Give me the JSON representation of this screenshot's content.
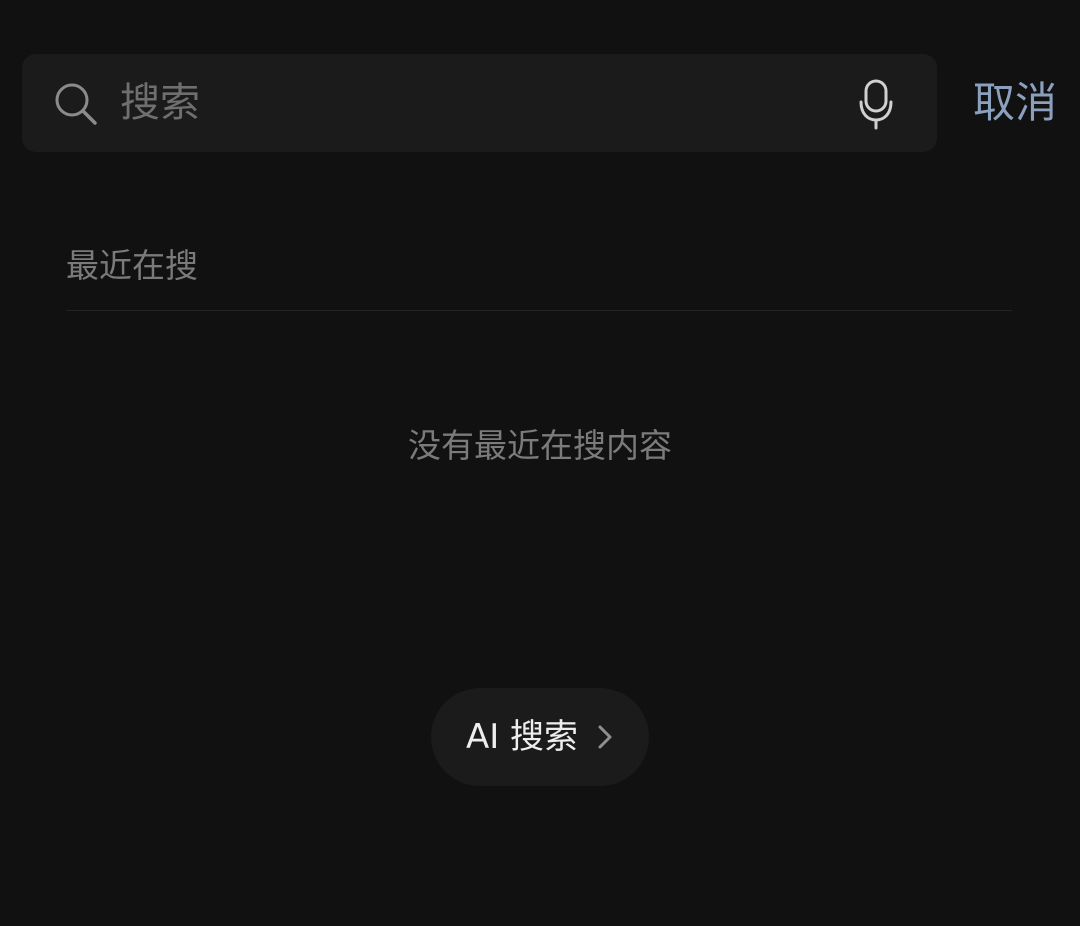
{
  "search": {
    "value": "",
    "placeholder": "搜索",
    "icon": "search-icon",
    "mic_icon": "microphone-icon"
  },
  "header": {
    "cancel_label": "取消"
  },
  "recent": {
    "title": "最近在搜",
    "empty_text": "没有最近在搜内容"
  },
  "ai_search": {
    "label": "AI 搜索",
    "icon": "chevron-right-icon"
  },
  "colors": {
    "background": "#111111",
    "surface": "#1b1b1b",
    "accent": "#8aa0bd",
    "muted_text": "#7a7a7a",
    "primary_text": "#eeeeee"
  }
}
